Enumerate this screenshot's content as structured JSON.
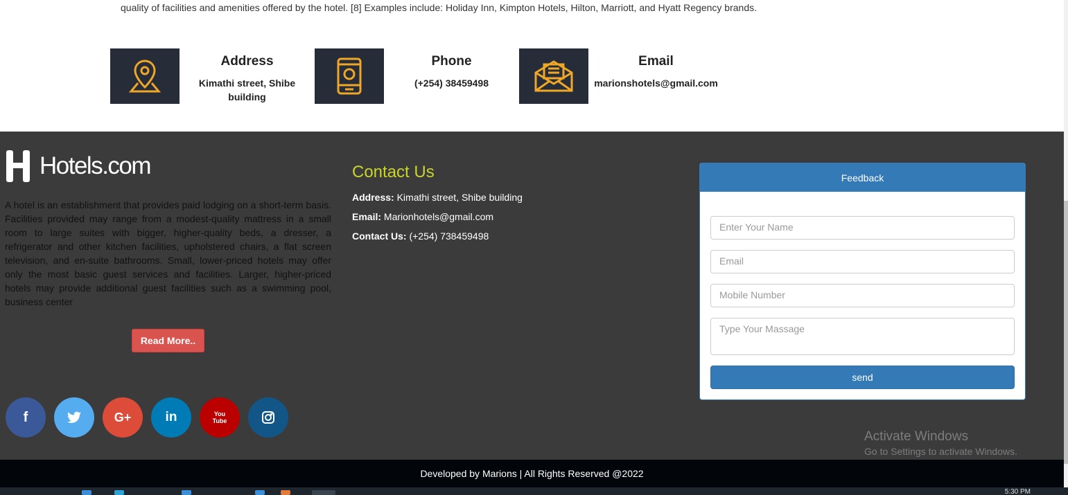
{
  "intro": {
    "text": "quality of facilities and amenities offered by the hotel. [8] Examples include: Holiday Inn, Kimpton Hotels, Hilton, Marriott, and Hyatt Regency brands."
  },
  "info_cards": [
    {
      "icon": "map-pin-icon",
      "title": "Address",
      "value": "Kimathi street, Shibe building"
    },
    {
      "icon": "phone-icon",
      "title": "Phone",
      "value": "(+254) 38459498"
    },
    {
      "icon": "envelope-icon",
      "title": "Email",
      "value": "marionshotels@gmail.com"
    }
  ],
  "footer": {
    "logo_text": "Hotels.com",
    "about": "A hotel is an establishment that provides paid lodging on a short-term basis. Facilities provided may range from a modest-quality mattress in a small room to large suites with bigger, higher-quality beds, a dresser, a refrigerator and other kitchen facilities, upholstered chairs, a flat screen television, and en-suite bathrooms. Small, lower-priced hotels may offer only the most basic guest services and facilities. Larger, higher-priced hotels may provide additional guest facilities such as a swimming pool, business center",
    "read_more": "Read More..",
    "socials": [
      {
        "name": "facebook",
        "glyph": "f",
        "color": "#3b5998"
      },
      {
        "name": "twitter",
        "glyph": "🐦",
        "color": "#55acee"
      },
      {
        "name": "google-plus",
        "glyph": "G+",
        "color": "#dd4b39"
      },
      {
        "name": "linkedin",
        "glyph": "in",
        "color": "#007bb5"
      },
      {
        "name": "youtube",
        "glyph": "You Tube",
        "color": "#bb0000"
      },
      {
        "name": "instagram",
        "glyph": "◎",
        "color": "#125688"
      }
    ],
    "contact": {
      "title": "Contact Us",
      "address_label": "Address:",
      "address": "Kimathi street, Shibe building",
      "email_label": "Email:",
      "email": "Marionhotels@gmail.com",
      "phone_label": "Contact Us:",
      "phone": "(+254) 738459498"
    },
    "feedback": {
      "title": "Feedback",
      "name_placeholder": "Enter Your Name",
      "email_placeholder": "Email",
      "mobile_placeholder": "Mobile Number",
      "message_placeholder": "Type Your Massage",
      "send_label": "send"
    },
    "copyright": "Developed by Marions | All Rights Reserved @2022"
  },
  "watermark": {
    "title": "Activate Windows",
    "subtitle": "Go to Settings to activate Windows."
  },
  "taskbar": {
    "clock": "5:30 PM"
  },
  "colors": {
    "footer_bg": "#3b3b3b",
    "icon_bg": "#262d38",
    "icon_stroke": "#f0a726",
    "accent_yellow": "#c9d52a",
    "primary_blue": "#337ab7",
    "danger_red": "#d9534f"
  }
}
